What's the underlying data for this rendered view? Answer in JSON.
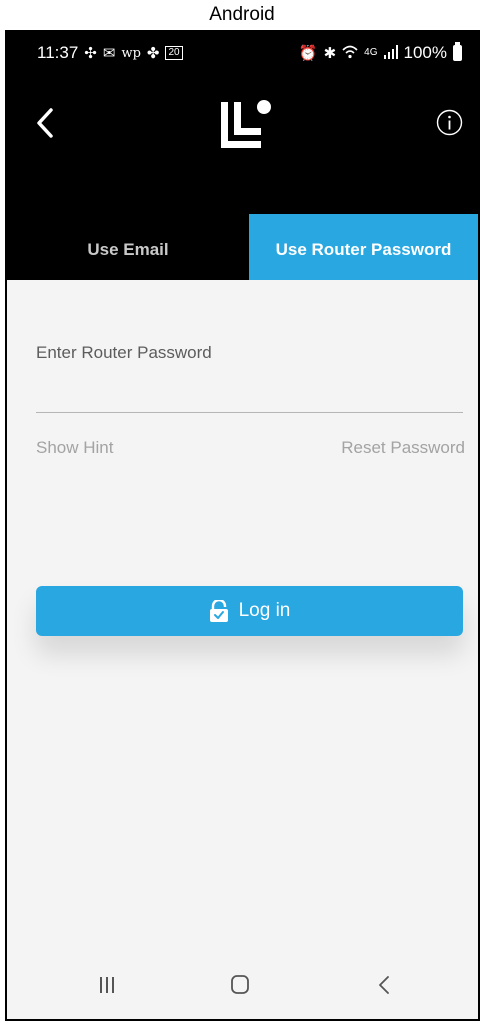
{
  "caption": "Android",
  "status_bar": {
    "time": "11:37",
    "left_icons": [
      "slack-icon",
      "mail-icon",
      "washington-post-icon",
      "pinwheel-icon",
      "calendar-icon"
    ],
    "calendar_day": "20",
    "right_icons": [
      "alarm-icon",
      "bluetooth-icon",
      "wifi-icon",
      "lte-icon",
      "signal-icon"
    ],
    "network": "4G",
    "battery": "100%"
  },
  "header": {
    "back_icon": "chevron-left-icon",
    "logo": "linksys-logo",
    "info_icon": "info-icon"
  },
  "tabs": [
    {
      "label": "Use Email",
      "active": false
    },
    {
      "label": "Use Router Password",
      "active": true
    }
  ],
  "form": {
    "password_label": "Enter Router Password",
    "password_value": "",
    "show_hint": "Show Hint",
    "reset_password": "Reset Password"
  },
  "login_button": {
    "label": "Log in",
    "icon": "unlock-icon"
  },
  "nav_bar": {
    "recent_icon": "recent-apps-icon",
    "home_icon": "home-icon",
    "back_icon": "back-icon"
  },
  "colors": {
    "accent": "#29a7e1",
    "header_bg": "#000000",
    "content_bg": "#f4f4f4"
  }
}
